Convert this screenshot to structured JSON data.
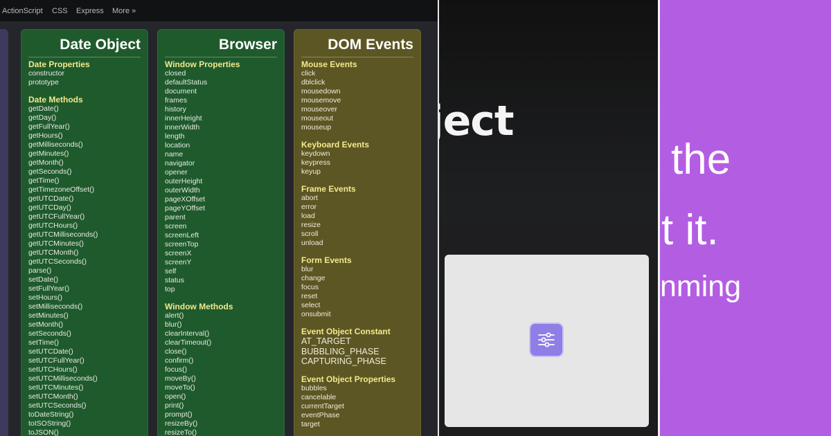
{
  "nav": [
    "ActionScript",
    "CSS",
    "Express",
    "More »"
  ],
  "columns": {
    "date": {
      "title": "Date Object",
      "sections": [
        {
          "head": "Date Properties",
          "items": [
            "constructor",
            "prototype"
          ]
        },
        {
          "head": "Date Methods",
          "items": [
            "getDate()",
            "getDay()",
            "getFullYear()",
            "getHours()",
            "getMilliseconds()",
            "getMinutes()",
            "getMonth()",
            "getSeconds()",
            "getTime()",
            "getTimezoneOffset()",
            "getUTCDate()",
            "getUTCDay()",
            "getUTCFullYear()",
            "getUTCHours()",
            "getUTCMilliseconds()",
            "getUTCMinutes()",
            "getUTCMonth()",
            "getUTCSeconds()",
            "parse()",
            "setDate()",
            "setFullYear()",
            "setHours()",
            "setMilliseconds()",
            "setMinutes()",
            "setMonth()",
            "setSeconds()",
            "setTime()",
            "setUTCDate()",
            "setUTCFullYear()",
            "setUTCHours()",
            "setUTCMilliseconds()",
            "setUTCMinutes()",
            "setUTCMonth()",
            "setUTCSeconds()",
            "toDateString()",
            "toISOString()",
            "toJSON()"
          ]
        }
      ]
    },
    "browser": {
      "title": "Browser",
      "sections": [
        {
          "head": "Window Properties",
          "items": [
            "closed",
            "defaultStatus",
            "document",
            "frames",
            "history",
            "innerHeight",
            "innerWidth",
            "length",
            "location",
            "name",
            "navigator",
            "opener",
            "outerHeight",
            "outerWidth",
            "pageXOffset",
            "pageYOffset",
            "parent",
            "screen",
            "screenLeft",
            "screenTop",
            "screenX",
            "screenY",
            "self",
            "status",
            "top"
          ]
        },
        {
          "head": "Window Methods",
          "items": [
            "alert()",
            "blur()",
            "clearInterval()",
            "clearTimeout()",
            "close()",
            "confirm()",
            "focus()",
            "moveBy()",
            "moveTo()",
            "open()",
            "print()",
            "prompt()",
            "resizeBy()",
            "resizeTo()"
          ]
        }
      ]
    },
    "dom": {
      "title": "DOM Events",
      "sections": [
        {
          "head": "Mouse Events",
          "items": [
            "click",
            "dblclick",
            "mousedown",
            "mousemove",
            "mouseover",
            "mouseout",
            "mouseup"
          ]
        },
        {
          "head": "Keyboard Events",
          "items": [
            "keydown",
            "keypress",
            "keyup"
          ]
        },
        {
          "head": "Frame Events",
          "items": [
            "abort",
            "error",
            "load",
            "resize",
            "scroll",
            "unload"
          ]
        },
        {
          "head": "Form Events",
          "items": [
            "blur",
            "change",
            "focus",
            "reset",
            "select",
            "onsubmit"
          ]
        },
        {
          "head": "Event Object Constant",
          "items": [
            "AT_TARGET",
            "BUBBLING_PHASE",
            "CAPTURING_PHASE"
          ],
          "big": true
        },
        {
          "head": "Event Object Properties",
          "items": [
            "bubbles",
            "cancelable",
            "currentTarget",
            "eventPhase",
            "target"
          ]
        }
      ]
    }
  },
  "middle": {
    "heading": "ject",
    "card_icon": "sliders-icon"
  },
  "right": {
    "line1": "the",
    "line2": "t it.",
    "line3": "nming"
  },
  "colors": {
    "green": "#1f5a2c",
    "olive": "#5c5624",
    "purple": "#b35ee2",
    "button": "#8e7ee6"
  }
}
